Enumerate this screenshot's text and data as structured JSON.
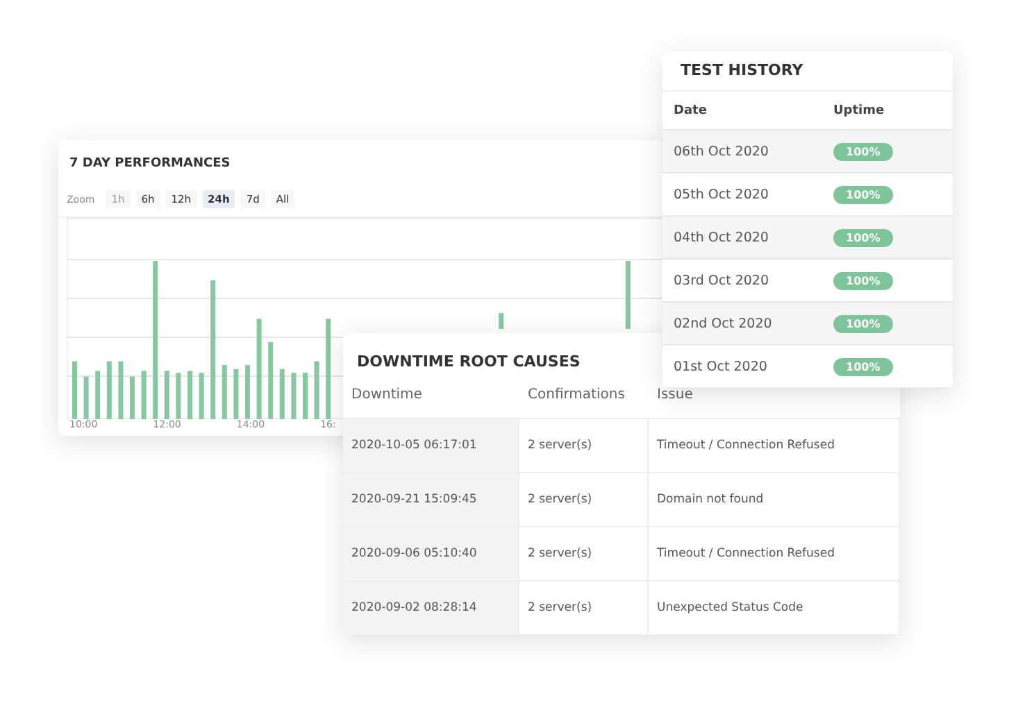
{
  "performance": {
    "title": "7 DAY PERFORMANCES",
    "zoom_label": "Zoom",
    "zoom_options": [
      {
        "label": "1h",
        "selected": false,
        "disabled": true
      },
      {
        "label": "6h",
        "selected": false,
        "disabled": false
      },
      {
        "label": "12h",
        "selected": false,
        "disabled": false
      },
      {
        "label": "24h",
        "selected": true,
        "disabled": false
      },
      {
        "label": "7d",
        "selected": false,
        "disabled": false
      },
      {
        "label": "All",
        "selected": false,
        "disabled": false
      }
    ],
    "x_labels": [
      "10:00",
      "12:00",
      "14:00",
      "16:"
    ]
  },
  "test_history": {
    "title": "TEST HISTORY",
    "columns": [
      "Date",
      "Uptime"
    ],
    "rows": [
      {
        "date": "06th Oct 2020",
        "uptime": "100%"
      },
      {
        "date": "05th Oct 2020",
        "uptime": "100%"
      },
      {
        "date": "04th Oct 2020",
        "uptime": "100%"
      },
      {
        "date": "03rd Oct 2020",
        "uptime": "100%"
      },
      {
        "date": "02nd Oct 2020",
        "uptime": "100%"
      },
      {
        "date": "01st Oct 2020",
        "uptime": "100%"
      }
    ]
  },
  "downtime": {
    "title": "DOWNTIME ROOT CAUSES",
    "columns": [
      "Downtime",
      "Confirmations",
      "Issue"
    ],
    "rows": [
      {
        "downtime": "2020-10-05 06:17:01",
        "confirmations": "2 server(s)",
        "issue": "Timeout / Connection Refused"
      },
      {
        "downtime": "2020-09-21 15:09:45",
        "confirmations": "2 server(s)",
        "issue": "Domain not found"
      },
      {
        "downtime": "2020-09-06 05:10:40",
        "confirmations": "2 server(s)",
        "issue": "Timeout / Connection Refused"
      },
      {
        "downtime": "2020-09-02 08:28:14",
        "confirmations": "2 server(s)",
        "issue": "Unexpected Status Code"
      }
    ]
  }
}
